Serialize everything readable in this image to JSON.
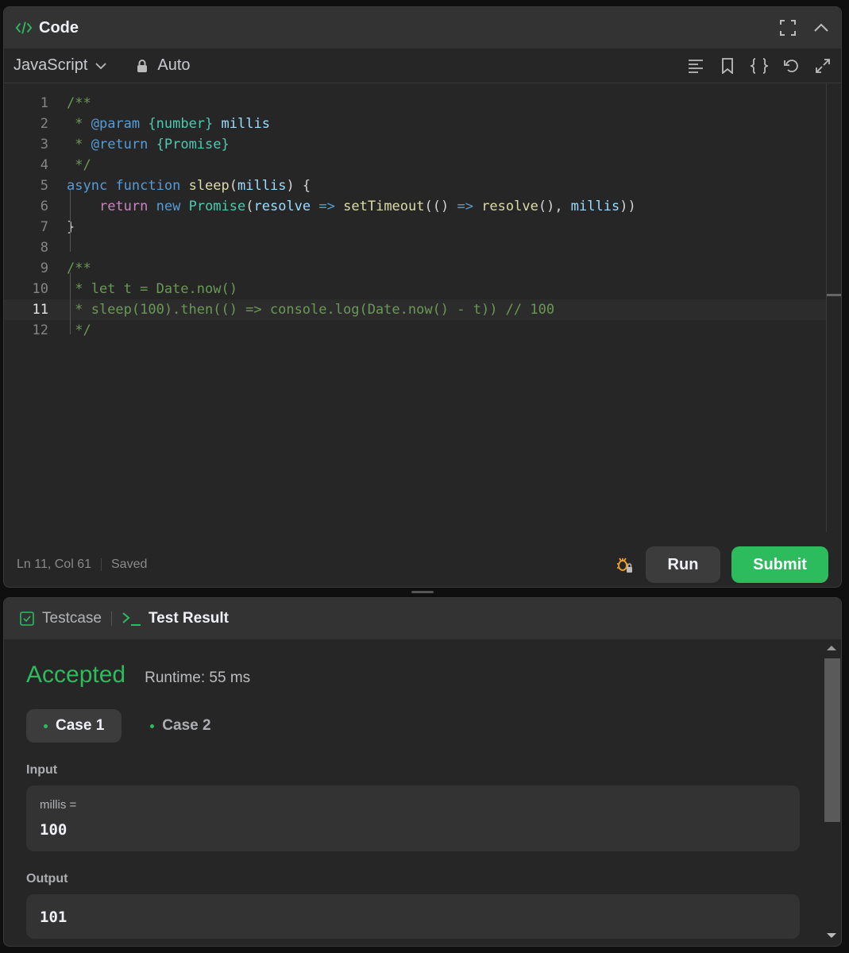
{
  "header": {
    "title": "Code"
  },
  "toolbar": {
    "language": "JavaScript",
    "mode": "Auto"
  },
  "editor": {
    "active_line": 11,
    "lines": [
      {
        "n": "1",
        "tokens": [
          {
            "t": "/**",
            "c": "com"
          }
        ]
      },
      {
        "n": "2",
        "tokens": [
          {
            "t": " * ",
            "c": "com"
          },
          {
            "t": "@param",
            "c": "tag"
          },
          {
            "t": " ",
            "c": "com"
          },
          {
            "t": "{number}",
            "c": "type"
          },
          {
            "t": " ",
            "c": "com"
          },
          {
            "t": "millis",
            "c": "var"
          }
        ]
      },
      {
        "n": "3",
        "tokens": [
          {
            "t": " * ",
            "c": "com"
          },
          {
            "t": "@return",
            "c": "tag"
          },
          {
            "t": " ",
            "c": "com"
          },
          {
            "t": "{Promise}",
            "c": "type"
          }
        ]
      },
      {
        "n": "4",
        "tokens": [
          {
            "t": " */",
            "c": "com"
          }
        ]
      },
      {
        "n": "5",
        "tokens": [
          {
            "t": "async",
            "c": "kw"
          },
          {
            "t": " ",
            "c": "pl"
          },
          {
            "t": "function",
            "c": "kw"
          },
          {
            "t": " ",
            "c": "pl"
          },
          {
            "t": "sleep",
            "c": "fn"
          },
          {
            "t": "(",
            "c": "pl"
          },
          {
            "t": "millis",
            "c": "var"
          },
          {
            "t": ") {",
            "c": "pl"
          }
        ]
      },
      {
        "n": "6",
        "tokens": [
          {
            "t": "    ",
            "c": "pl"
          },
          {
            "t": "return",
            "c": "ctl"
          },
          {
            "t": " ",
            "c": "pl"
          },
          {
            "t": "new",
            "c": "kw"
          },
          {
            "t": " ",
            "c": "pl"
          },
          {
            "t": "Promise",
            "c": "type"
          },
          {
            "t": "(",
            "c": "pl"
          },
          {
            "t": "resolve",
            "c": "var"
          },
          {
            "t": " ",
            "c": "pl"
          },
          {
            "t": "=>",
            "c": "kw"
          },
          {
            "t": " ",
            "c": "pl"
          },
          {
            "t": "setTimeout",
            "c": "fn"
          },
          {
            "t": "(() ",
            "c": "pl"
          },
          {
            "t": "=>",
            "c": "kw"
          },
          {
            "t": " ",
            "c": "pl"
          },
          {
            "t": "resolve",
            "c": "fn"
          },
          {
            "t": "(), ",
            "c": "pl"
          },
          {
            "t": "millis",
            "c": "var"
          },
          {
            "t": "))",
            "c": "pl"
          }
        ]
      },
      {
        "n": "7",
        "tokens": [
          {
            "t": "}",
            "c": "pl"
          }
        ]
      },
      {
        "n": "8",
        "tokens": []
      },
      {
        "n": "9",
        "tokens": [
          {
            "t": "/**",
            "c": "com"
          }
        ]
      },
      {
        "n": "10",
        "tokens": [
          {
            "t": " * let t = Date.now()",
            "c": "com"
          }
        ]
      },
      {
        "n": "11",
        "tokens": [
          {
            "t": " * sleep(100).then(() => console.log(Date.now() - t)) // 100",
            "c": "com"
          }
        ]
      },
      {
        "n": "12",
        "tokens": [
          {
            "t": " */",
            "c": "com"
          }
        ]
      }
    ]
  },
  "status": {
    "position": "Ln 11, Col 61",
    "saved": "Saved",
    "run_label": "Run",
    "submit_label": "Submit"
  },
  "result_tabs": {
    "testcase": "Testcase",
    "test_result": "Test Result"
  },
  "result": {
    "verdict": "Accepted",
    "runtime": "Runtime: 55 ms",
    "cases": [
      "Case 1",
      "Case 2"
    ],
    "input_label": "Input",
    "input_key": "millis =",
    "input_value": "100",
    "output_label": "Output",
    "output_value": "101"
  },
  "colors": {
    "accent": "#2cbb5d",
    "panel": "#262626",
    "header": "#333333"
  },
  "icons": [
    "code-icon",
    "fullscreen-icon",
    "chevron-up-icon",
    "chevron-down-icon",
    "lock-icon",
    "format-icon",
    "bookmark-icon",
    "braces-icon",
    "reset-icon",
    "expand-icon",
    "debug-icon",
    "checkbox-icon",
    "terminal-icon"
  ]
}
